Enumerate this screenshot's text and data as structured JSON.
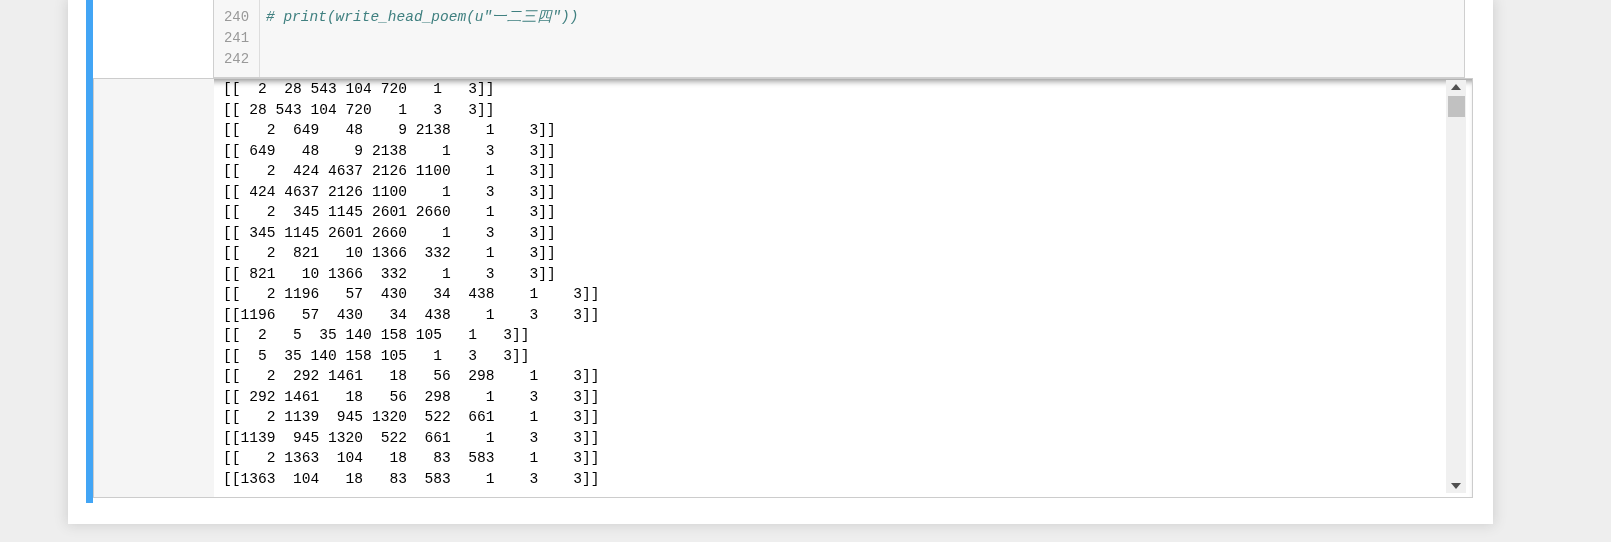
{
  "code_cell": {
    "lines": [
      {
        "number": "240",
        "code": "# print(write_head_poem(u\"一二三四\"))",
        "kind": "comment"
      },
      {
        "number": "241",
        "kind": "blank"
      },
      {
        "number": "242",
        "kind": "blank"
      }
    ]
  },
  "output": {
    "lines": [
      "[[  2  28 543 104 720   1   3]]",
      "[[ 28 543 104 720   1   3   3]]",
      "[[   2  649   48    9 2138    1    3]]",
      "[[ 649   48    9 2138    1    3    3]]",
      "[[   2  424 4637 2126 1100    1    3]]",
      "[[ 424 4637 2126 1100    1    3    3]]",
      "[[   2  345 1145 2601 2660    1    3]]",
      "[[ 345 1145 2601 2660    1    3    3]]",
      "[[   2  821   10 1366  332    1    3]]",
      "[[ 821   10 1366  332    1    3    3]]",
      "[[   2 1196   57  430   34  438    1    3]]",
      "[[1196   57  430   34  438    1    3    3]]",
      "[[  2   5  35 140 158 105   1   3]]",
      "[[  5  35 140 158 105   1   3   3]]",
      "[[   2  292 1461   18   56  298    1    3]]",
      "[[ 292 1461   18   56  298    1    3    3]]",
      "[[   2 1139  945 1320  522  661    1    3]]",
      "[[1139  945 1320  522  661    1    3    3]]",
      "[[   2 1363  104   18   83  583    1    3]]",
      "[[1363  104   18   83  583    1    3    3]]"
    ]
  }
}
